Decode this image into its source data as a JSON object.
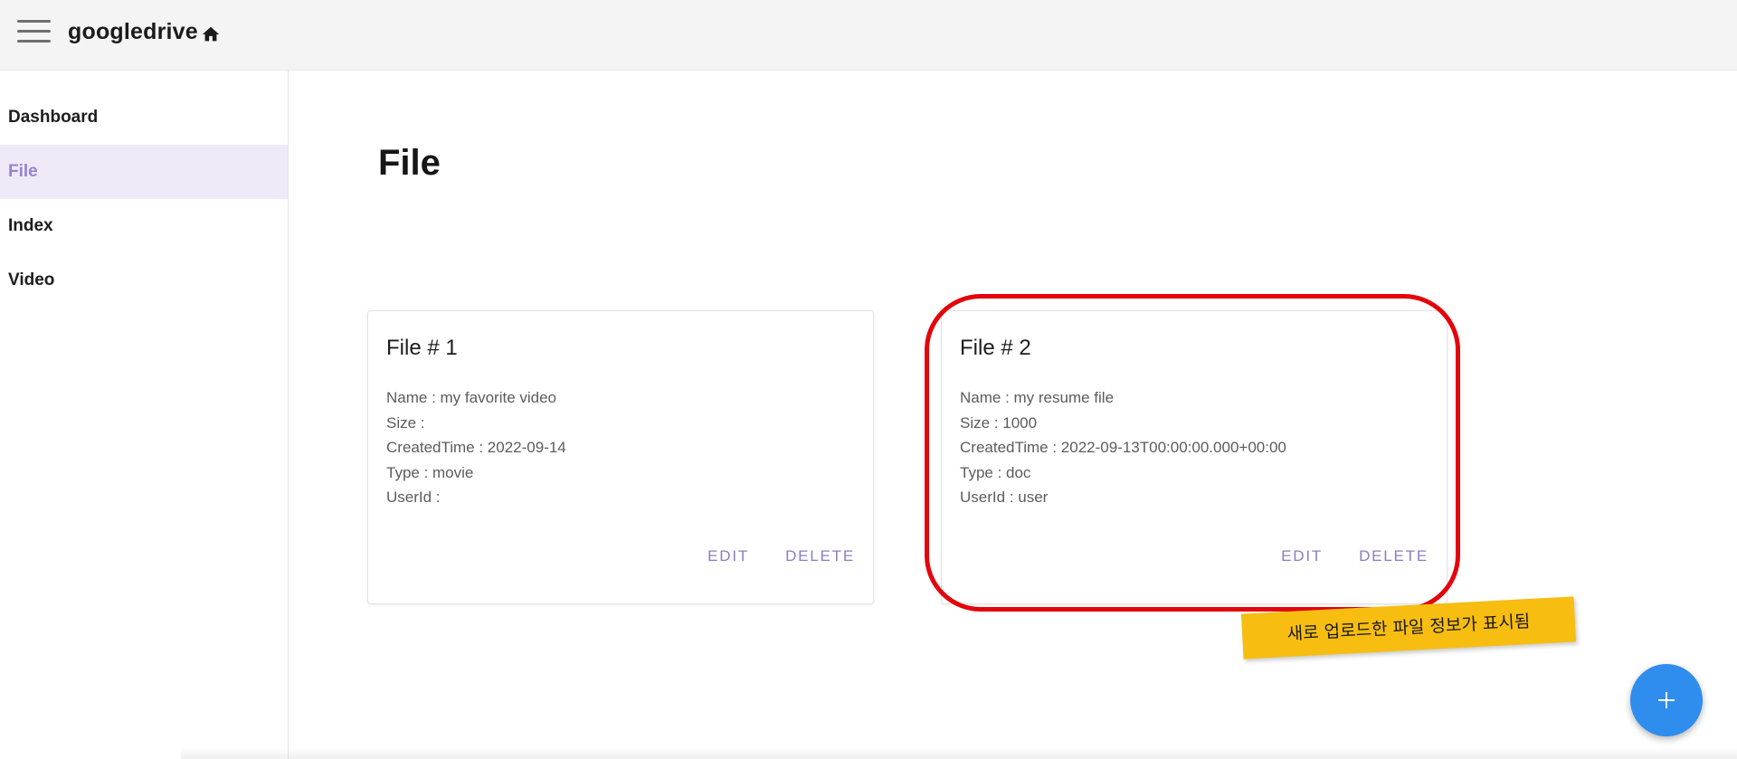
{
  "app": {
    "title": "googledrive"
  },
  "icons": {
    "menu": "hamburger-menu-icon",
    "home": "home-icon",
    "add": "plus-icon"
  },
  "sidebar": {
    "items": [
      {
        "label": "Dashboard",
        "active": false
      },
      {
        "label": "File",
        "active": true
      },
      {
        "label": "Index",
        "active": false
      },
      {
        "label": "Video",
        "active": false
      }
    ]
  },
  "page": {
    "title": "File"
  },
  "cards": [
    {
      "title": "File # 1",
      "fields": [
        "Name : my favorite video",
        "Size :",
        "CreatedTime : 2022-09-14",
        "Type : movie",
        "UserId :"
      ],
      "edit_label": "EDIT",
      "delete_label": "DELETE"
    },
    {
      "title": "File # 2",
      "fields": [
        "Name : my resume file",
        "Size : 1000",
        "CreatedTime : 2022-09-13T00:00:00.000+00:00",
        "Type : doc",
        "UserId : user"
      ],
      "edit_label": "EDIT",
      "delete_label": "DELETE"
    }
  ],
  "annotation": {
    "note": "새로 업로드한 파일 정보가 표시됨"
  },
  "colors": {
    "accent": "#8e7cc3",
    "active_bg": "#efe9f8",
    "highlight": "#e3040c",
    "note_bg": "#f7bd10",
    "fab": "#2f8ded"
  }
}
